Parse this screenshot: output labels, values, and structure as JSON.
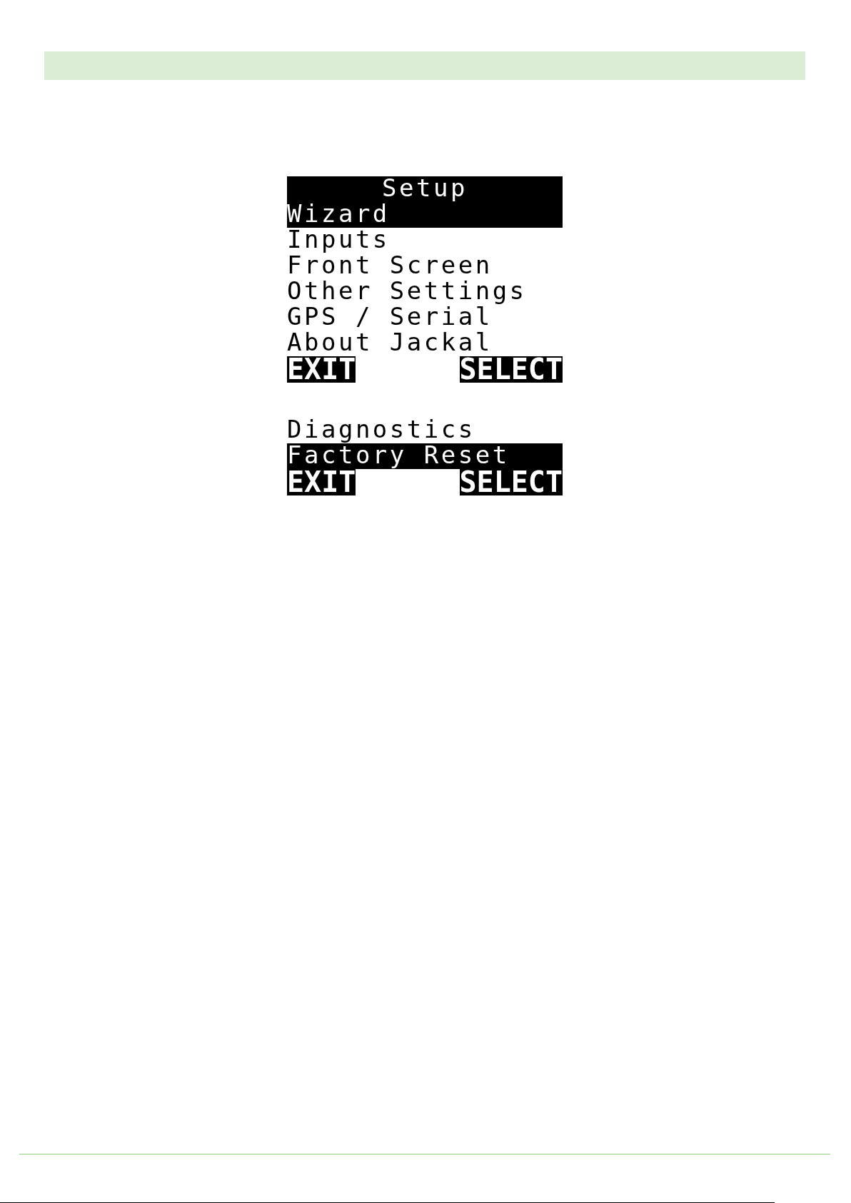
{
  "screens": [
    {
      "title": "Setup",
      "items": [
        {
          "label": "Wizard",
          "selected": true
        },
        {
          "label": "Inputs",
          "selected": false
        },
        {
          "label": "Front Screen",
          "selected": false
        },
        {
          "label": "Other Settings",
          "selected": false
        },
        {
          "label": "GPS / Serial",
          "selected": false
        },
        {
          "label": "About Jackal",
          "selected": false
        }
      ],
      "softkeys": {
        "left": "EXIT",
        "right": "SELECT"
      }
    },
    {
      "items": [
        {
          "label": "Diagnostics",
          "selected": false
        },
        {
          "label": "Factory Reset",
          "selected": true
        }
      ],
      "softkeys": {
        "left": "EXIT",
        "right": "SELECT"
      }
    }
  ]
}
